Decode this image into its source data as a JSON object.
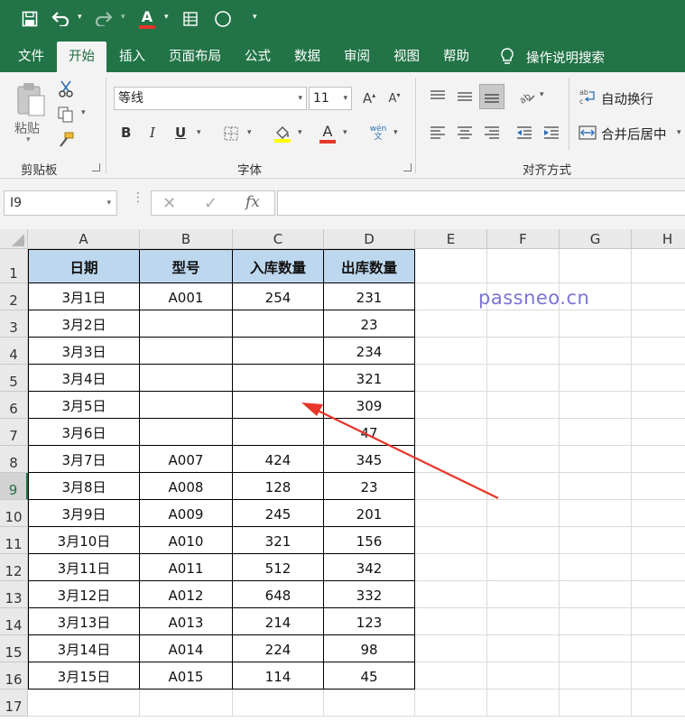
{
  "ribbon_tabs": [
    "文件",
    "开始",
    "插入",
    "页面布局",
    "公式",
    "数据",
    "审阅",
    "视图",
    "帮助"
  ],
  "active_tab": "开始",
  "search_label": "操作说明搜索",
  "clipboard": {
    "paste_label": "粘贴",
    "group_label": "剪贴板"
  },
  "font": {
    "family": "等线",
    "size": "11",
    "group_label": "字体",
    "bold": "B",
    "italic": "I",
    "underline": "U",
    "grow": "A",
    "shrink": "A",
    "color_letter": "A",
    "phonetic": "wén文"
  },
  "alignment": {
    "wrap_label": "自动换行",
    "merge_label": "合并后居中",
    "group_label": "对齐方式"
  },
  "name_box": "I9",
  "fx_label": "fx",
  "columns": [
    "A",
    "B",
    "C",
    "D",
    "E",
    "F",
    "G",
    "H"
  ],
  "rows": [
    "1",
    "2",
    "3",
    "4",
    "5",
    "6",
    "7",
    "8",
    "9",
    "10",
    "11",
    "12",
    "13",
    "14",
    "15",
    "16",
    "17"
  ],
  "selected_row": "9",
  "table": {
    "headers": [
      "日期",
      "型号",
      "入库数量",
      "出库数量"
    ],
    "rows": [
      [
        "3月1日",
        "A001",
        "254",
        "231"
      ],
      [
        "3月2日",
        "",
        "",
        "23"
      ],
      [
        "3月3日",
        "",
        "",
        "234"
      ],
      [
        "3月4日",
        "",
        "",
        "321"
      ],
      [
        "3月5日",
        "",
        "",
        "309"
      ],
      [
        "3月6日",
        "",
        "",
        "47"
      ],
      [
        "3月7日",
        "A007",
        "424",
        "345"
      ],
      [
        "3月8日",
        "A008",
        "128",
        "23"
      ],
      [
        "3月9日",
        "A009",
        "245",
        "201"
      ],
      [
        "3月10日",
        "A010",
        "321",
        "156"
      ],
      [
        "3月11日",
        "A011",
        "512",
        "342"
      ],
      [
        "3月12日",
        "A012",
        "648",
        "332"
      ],
      [
        "3月13日",
        "A013",
        "214",
        "123"
      ],
      [
        "3月14日",
        "A014",
        "224",
        "98"
      ],
      [
        "3月15日",
        "A015",
        "114",
        "45"
      ]
    ]
  },
  "watermark": "passneo.cn",
  "colors": {
    "excel_green": "#227447",
    "header_fill": "#bdd7ee",
    "arrow_red": "#e8362a",
    "watermark": "#7b74d6"
  }
}
